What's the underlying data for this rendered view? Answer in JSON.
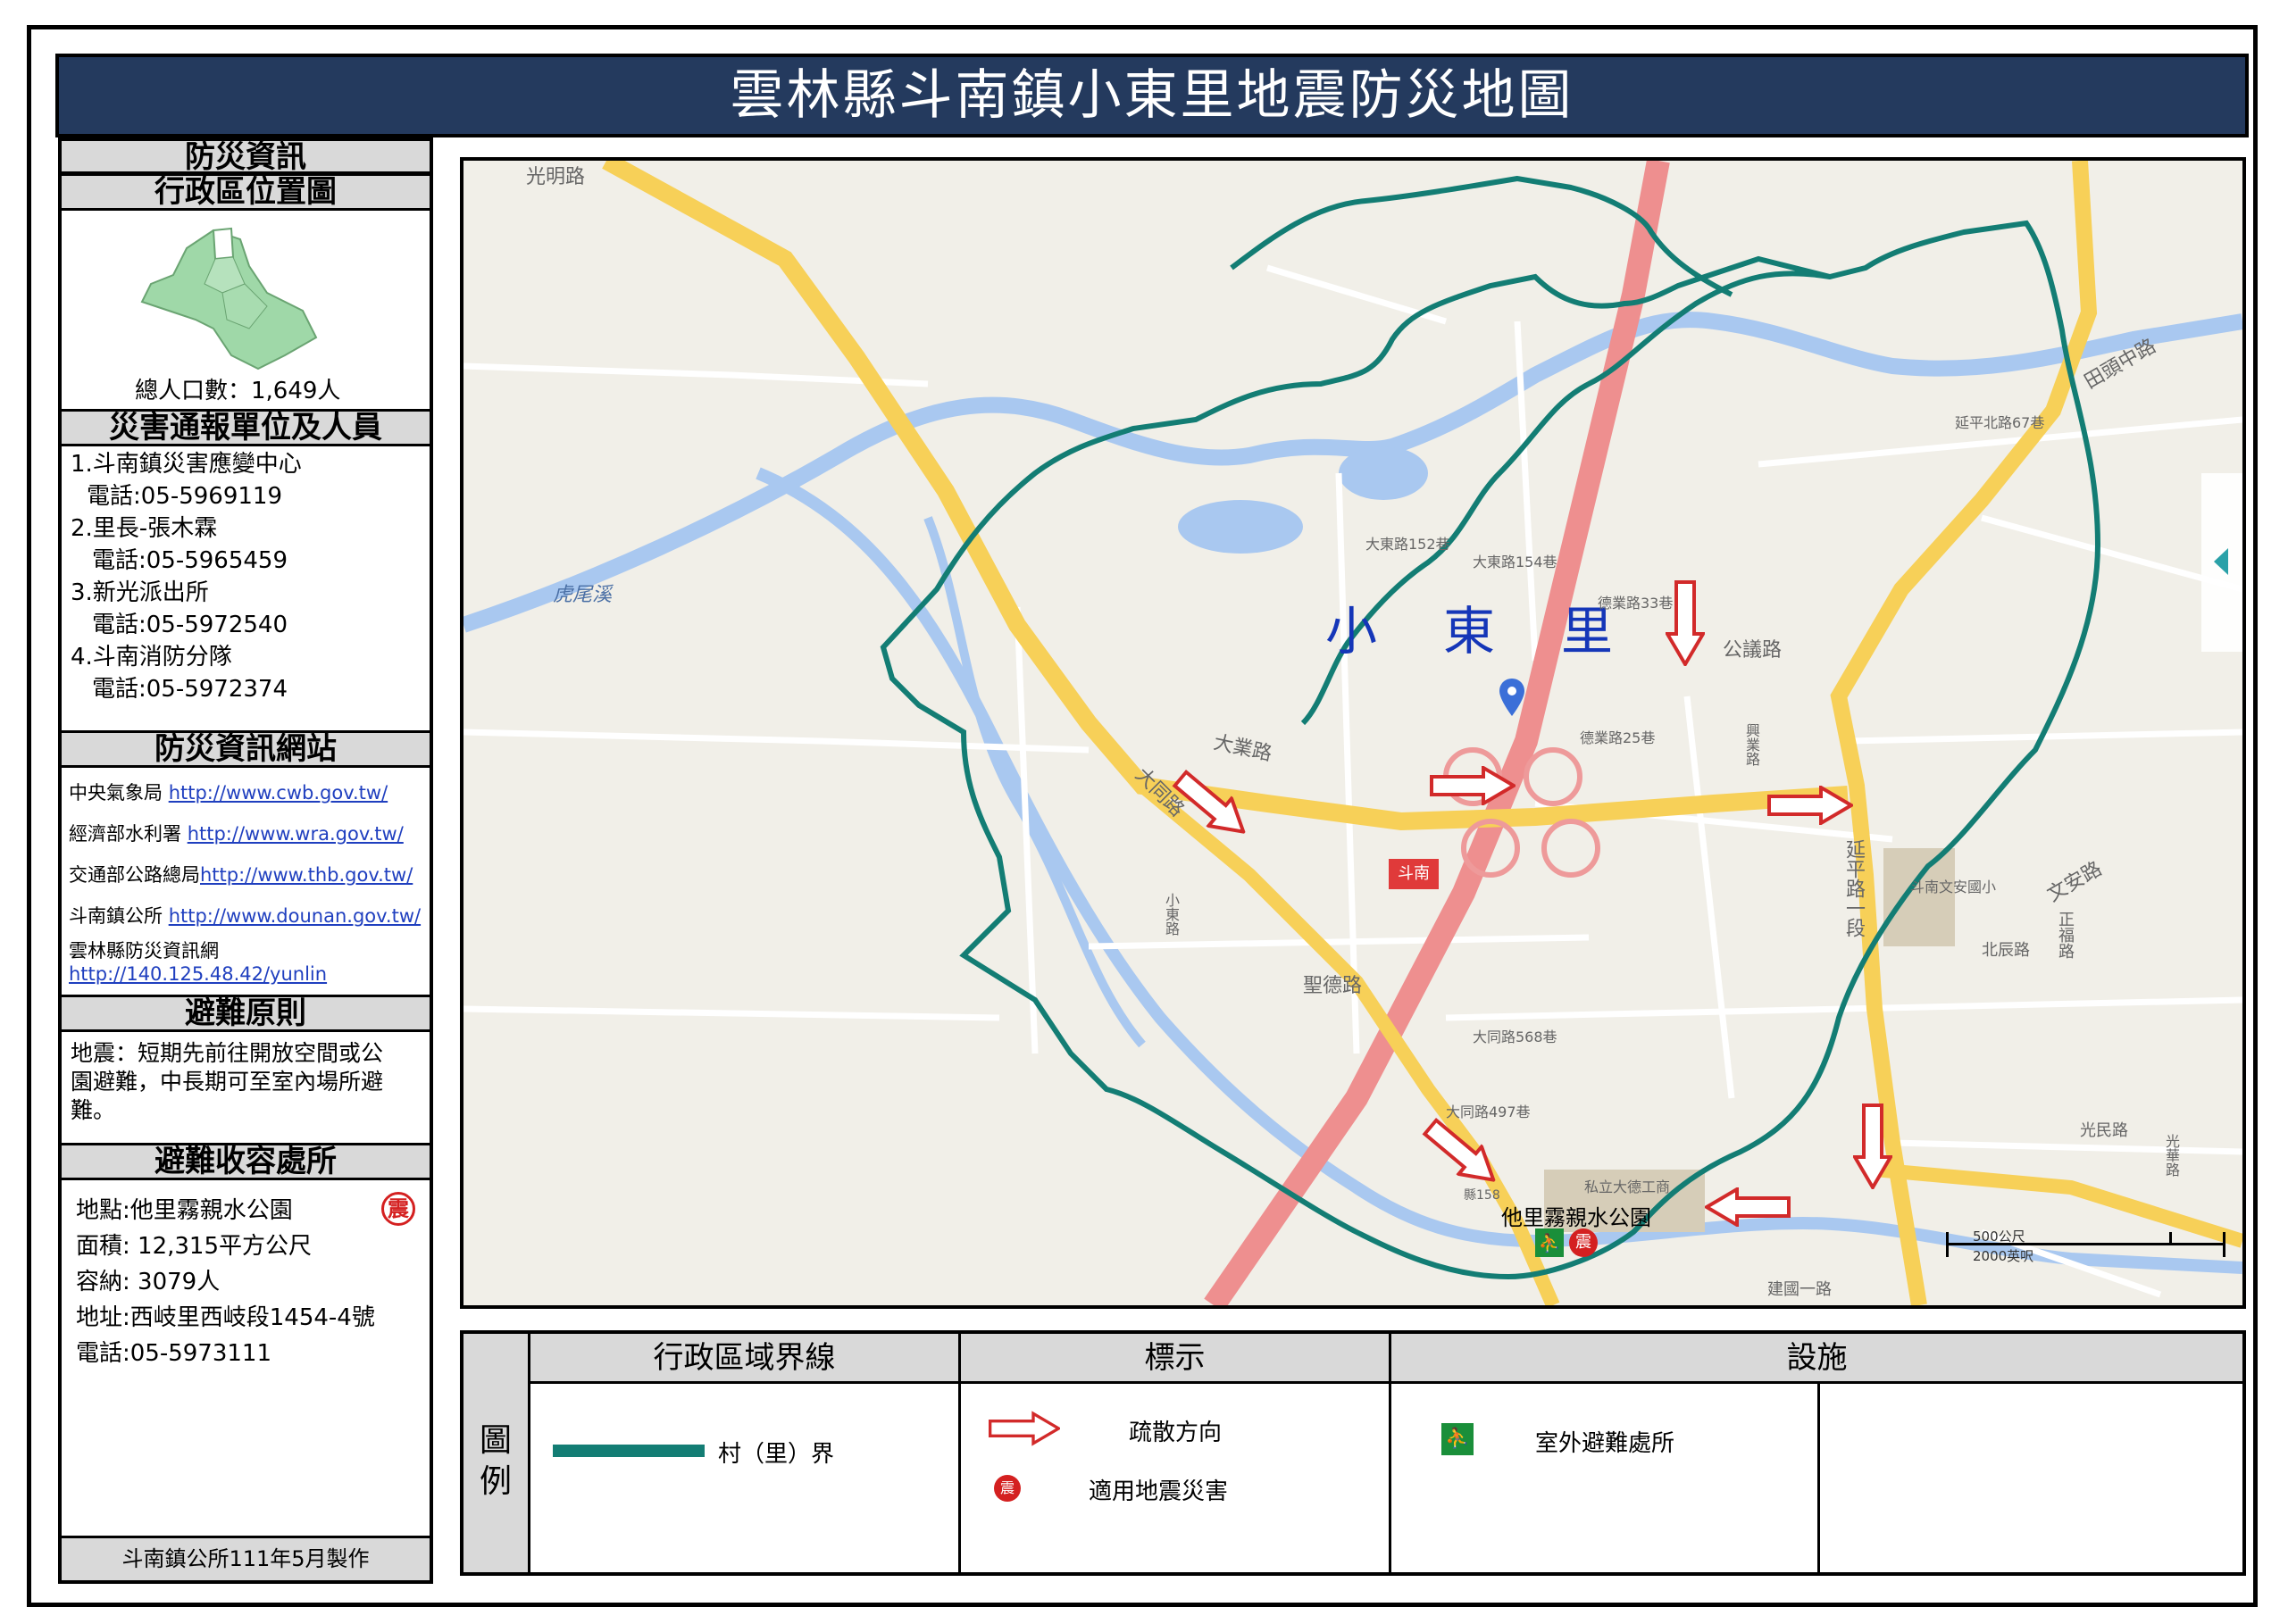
{
  "title": "雲林縣斗南鎮小東里地震防災地圖",
  "left_panel": {
    "header_main": "防災資訊",
    "header_location": "行政區位置圖",
    "population": "總人口數：1,649人",
    "header_contacts": "災害通報單位及人員",
    "contacts": [
      {
        "name": "1.斗南鎮災害應變中心",
        "phone": "電話:05-5969119"
      },
      {
        "name": "2.里長-張木霖",
        "phone": "電話:05-5965459"
      },
      {
        "name": "3.新光派出所",
        "phone": "電話:05-5972540"
      },
      {
        "name": "4.斗南消防分隊",
        "phone": "電話:05-5972374"
      }
    ],
    "header_websites": "防災資訊網站",
    "websites": [
      {
        "org": "中央氣象局",
        "url": "http://www.cwb.gov.tw/"
      },
      {
        "org": "經濟部水利署",
        "url": "http://www.wra.gov.tw/"
      },
      {
        "org": "交通部公路總局",
        "url": "http://www.thb.gov.tw/"
      },
      {
        "org": "斗南鎮公所",
        "url": "http://www.dounan.gov.tw/"
      },
      {
        "org": "雲林縣防災資訊網",
        "url": "http://140.125.48.42/yunlin"
      }
    ],
    "header_principle": "避難原則",
    "principle_lines": [
      "地震：短期先前往開放空間或公",
      "園避難，中長期可至室內場所避",
      "難。"
    ],
    "header_shelter": "避難收容處所",
    "shelter": {
      "location": "地點:他里霧親水公園",
      "area": "面積: 12,315平方公尺",
      "capacity": "容納: 3079人",
      "address": "地址:西岐里西岐段1454-4號",
      "phone": "電話:05-5973111"
    },
    "quake_badge": "震",
    "footer": "斗南鎮公所111年5月製作"
  },
  "map": {
    "village_label": "小　東　里",
    "park_label": "他里霧親水公園",
    "station_label": "斗南",
    "river_label": "虎尾溪",
    "school_label_1": "私立大德工商",
    "school_label_2": "斗南文安國小",
    "scale_top": "500公尺",
    "scale_bottom": "2000英呎",
    "roads": [
      "大業路",
      "大同路",
      "延平路一段",
      "文安路",
      "田頭中路",
      "光明路",
      "大同路497巷",
      "大同路568巷",
      "公議路",
      "德業路25巷",
      "聖德路",
      "北辰路",
      "正福路",
      "光民路",
      "延平北路67巷",
      "光華路",
      "建國一路",
      "大東路152巷",
      "大東路154巷",
      "德業路33巷",
      "興業路",
      "小東路",
      "縣158"
    ]
  },
  "legend": {
    "side_title": [
      "圖",
      "例"
    ],
    "col1_header": "行政區域界線",
    "col2_header": "標示",
    "col3_header": "設施",
    "boundary_label": "村（里）界",
    "arrow_label": "疏散方向",
    "quake_label": "適用地震災害",
    "shelter_label": "室外避難處所"
  },
  "colors": {
    "title_bg": "#243a5e",
    "boundary": "#137d74",
    "road_main": "#f7d058",
    "highway": "#ee8f8f",
    "river": "#a9c8f0",
    "arrow": "#d22a2a",
    "quake_badge": "#d42020",
    "shelter_icon": "#1a8f3a"
  }
}
